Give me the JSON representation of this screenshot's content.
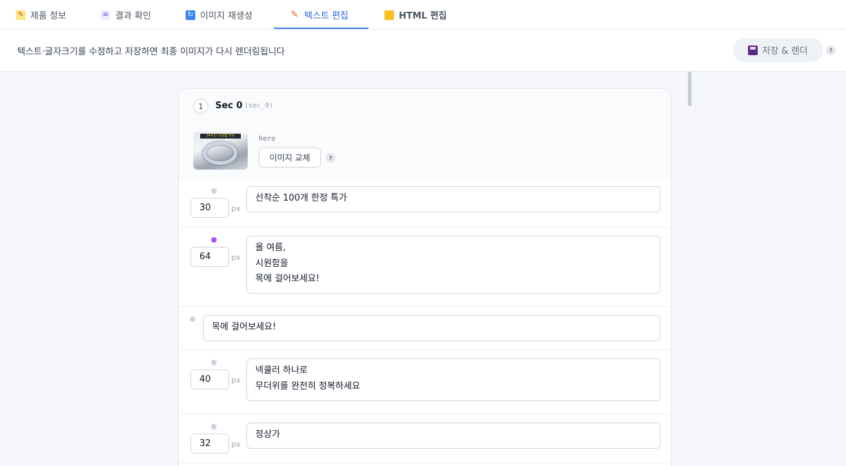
{
  "tabs": [
    {
      "label": "제품 정보",
      "icon": "memo-pencil-icon",
      "color": "#d97706"
    },
    {
      "label": "결과 확인",
      "icon": "document-icon",
      "color": "#8b5cf6"
    },
    {
      "label": "이미지 재생성",
      "icon": "refresh-icon",
      "color": "#3b82f6"
    },
    {
      "label": "텍스트 편집",
      "icon": "pencil-icon",
      "color": "#f97316"
    },
    {
      "label": "HTML 편집",
      "icon": "folder-icon",
      "color": "#f59e0b"
    }
  ],
  "active_tab": "텍스트 편집",
  "toolbar": {
    "hint": "텍스트·글자크기를 수정하고 저장하면 최종 이미지가 다시 렌더링됩니다",
    "save_label": "저장 & 렌더",
    "help": "?"
  },
  "section": {
    "number": "1",
    "title": "Sec 0",
    "id": "(sec_0)",
    "image": {
      "label": "hero",
      "thumb_caption": "24시간 시원함 지속",
      "replace_label": "이미지 교체",
      "help": "?"
    },
    "fields": [
      {
        "size": "30",
        "unit": "px",
        "text": "선착순 100개 한정 특가",
        "accent": false
      },
      {
        "size": "64",
        "unit": "px",
        "text": "올 여름,\n시원함을\n목에 걸어보세요!",
        "accent": true
      },
      {
        "size": "",
        "unit": "",
        "text": "목에 걸어보세요!",
        "accent": false
      },
      {
        "size": "40",
        "unit": "px",
        "text": "넥쿨러 하나로\n무더위를 완전히 정복하세요",
        "accent": false
      },
      {
        "size": "32",
        "unit": "px",
        "text": "정상가",
        "accent": false
      }
    ]
  }
}
